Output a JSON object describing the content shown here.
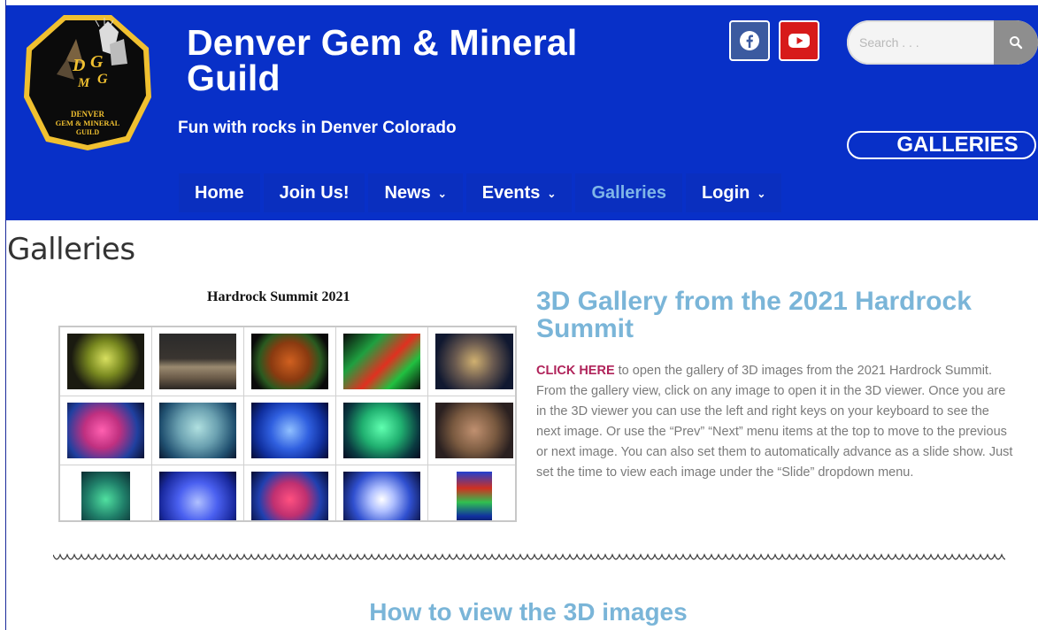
{
  "site": {
    "title": "Denver Gem & Mineral Guild",
    "tagline": "Fun with rocks in Denver Colorado",
    "logo": {
      "letters": "DGMG",
      "text_line1": "DENVER",
      "text_line2": "GEM & MINERAL",
      "text_line3": "GUILD"
    },
    "colors": {
      "header_bg": "#0830c8",
      "accent_link": "#7ab5d8",
      "cta": "#b0235a"
    }
  },
  "social": {
    "facebook_icon": "facebook-icon",
    "youtube_icon": "youtube-icon"
  },
  "search": {
    "placeholder": "Search . . ."
  },
  "galleries_button": {
    "label": "GALLERIES"
  },
  "nav": {
    "items": [
      {
        "label": "Home",
        "dropdown": false
      },
      {
        "label": "Join Us!",
        "dropdown": false
      },
      {
        "label": "News",
        "dropdown": true
      },
      {
        "label": "Events",
        "dropdown": true
      },
      {
        "label": "Galleries",
        "dropdown": false,
        "active": true
      },
      {
        "label": "Login",
        "dropdown": true
      }
    ]
  },
  "main": {
    "page_title": "Galleries",
    "thumbnail_caption": "Hardrock Summit 2021",
    "gallery_heading": "3D Gallery from the 2021 Hardrock Summit",
    "gallery_cta": "CLICK HERE",
    "gallery_text": "to open the gallery of 3D images from the 2021 Hardrock Summit. From the gallery view, click on any image to open it in the 3D viewer. Once you are in the 3D viewer you can use the left and right keys on your keyboard to see the next image. Or use the “Prev” “Next” menu items at the top to move to the previous or next image. You can also set them to automatically advance as a slide show. Just set the time to view each image under the “Slide” dropdown menu.",
    "section_heading": "How to view the 3D images"
  }
}
